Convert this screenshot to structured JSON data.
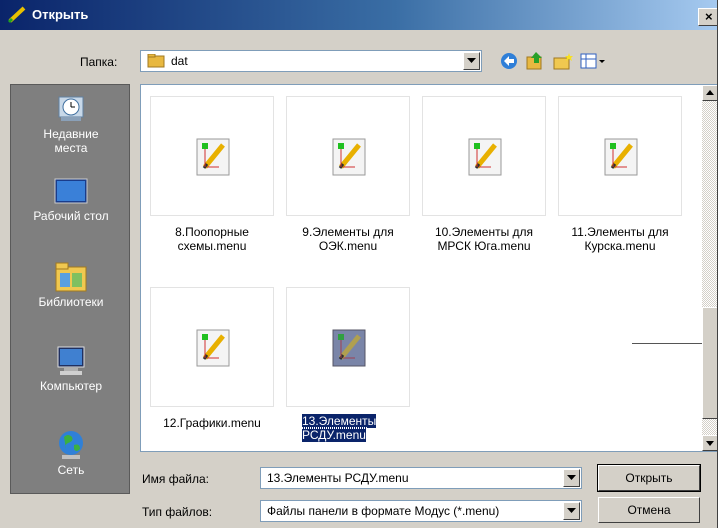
{
  "window": {
    "title": "Открыть",
    "close_glyph": "×"
  },
  "location": {
    "label": "Папка:",
    "folder": "dat"
  },
  "toolbar": {
    "icons": [
      "back-icon",
      "up-folder-icon",
      "new-folder-icon",
      "view-menu-icon"
    ]
  },
  "places": [
    {
      "label_1": "Недавние",
      "label_2": "места",
      "icon": "recent-places-icon"
    },
    {
      "label_1": "Рабочий стол",
      "label_2": "",
      "icon": "desktop-icon"
    },
    {
      "label_1": "Библиотеки",
      "label_2": "",
      "icon": "libraries-icon"
    },
    {
      "label_1": "Компьютер",
      "label_2": "",
      "icon": "computer-icon"
    },
    {
      "label_1": "Сеть",
      "label_2": "",
      "icon": "network-icon"
    }
  ],
  "files": [
    {
      "line_1": "8.Поопорные",
      "line_2": "схемы.menu",
      "selected": false
    },
    {
      "line_1": "9.Элементы для",
      "line_2": "ОЭК.menu",
      "selected": false
    },
    {
      "line_1": "10.Элементы для",
      "line_2": "МРСК Юга.menu",
      "selected": false
    },
    {
      "line_1": "11.Элементы для",
      "line_2": "Курска.menu",
      "selected": false
    },
    {
      "line_1": "12.Графики.menu",
      "line_2": "",
      "selected": false
    },
    {
      "line_1": "13.Элементы",
      "line_2": "РСДУ.menu",
      "selected": true
    }
  ],
  "filename": {
    "label": "Имя файла:",
    "value": "13.Элементы РСДУ.menu"
  },
  "filetype": {
    "label": "Тип файлов:",
    "value": "Файлы панели в формате Модус (*.menu)"
  },
  "buttons": {
    "open": "Открыть",
    "cancel": "Отмена"
  },
  "colors": {
    "selection": "#0a246a",
    "places_bg": "#7f7f7f",
    "dialog_bg": "#d4d0c8"
  }
}
